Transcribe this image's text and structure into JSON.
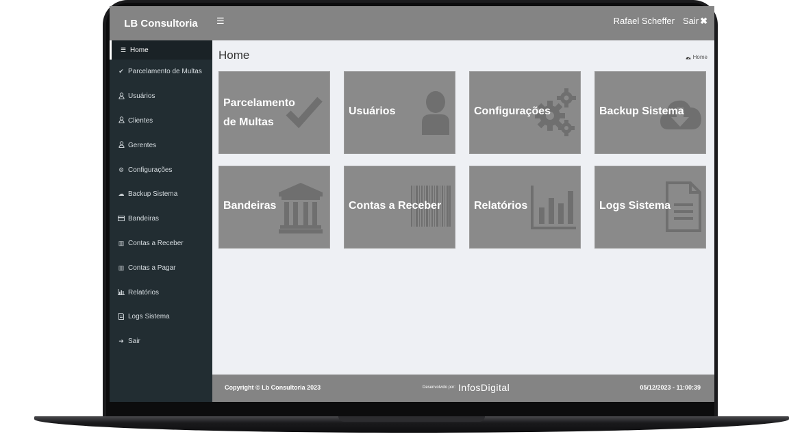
{
  "header": {
    "brand": "LB Consultoria",
    "menu_icon": "☰",
    "user_name": "Rafael Scheffer",
    "logout_label": "Sair",
    "logout_icon": "✖"
  },
  "sidebar": {
    "items": [
      {
        "label": "Home",
        "icon": "bars-icon"
      },
      {
        "label": "Parcelamento de Multas",
        "icon": "check-icon"
      },
      {
        "label": "Usuários",
        "icon": "user-icon"
      },
      {
        "label": "Clientes",
        "icon": "user-icon"
      },
      {
        "label": "Gerentes",
        "icon": "user-icon"
      },
      {
        "label": "Configurações",
        "icon": "cogs-icon"
      },
      {
        "label": "Backup Sistema",
        "icon": "cloud-download-icon"
      },
      {
        "label": "Bandeiras",
        "icon": "credit-card-icon"
      },
      {
        "label": "Contas a Receber",
        "icon": "barcode-icon"
      },
      {
        "label": "Contas a Pagar",
        "icon": "barcode-icon"
      },
      {
        "label": "Relatórios",
        "icon": "bar-chart-icon"
      },
      {
        "label": "Logs Sistema",
        "icon": "file-text-icon"
      },
      {
        "label": "Sair",
        "icon": "sign-out-icon"
      }
    ]
  },
  "page": {
    "title": "Home",
    "breadcrumb": "Home"
  },
  "tiles": [
    {
      "label_line1": "Parcelamento",
      "label_line2": "de Multas",
      "icon": "check-icon"
    },
    {
      "label_line1": "Usuários",
      "icon": "user-icon"
    },
    {
      "label_line1": "Configurações",
      "icon": "cogs-icon"
    },
    {
      "label_line1": "Backup Sistema",
      "icon": "cloud-download-icon"
    },
    {
      "label_line1": "Bandeiras",
      "icon": "bank-icon"
    },
    {
      "label_line1": "Contas a Receber",
      "icon": "barcode-icon"
    },
    {
      "label_line1": "Relatórios",
      "icon": "bar-chart-icon"
    },
    {
      "label_line1": "Logs Sistema",
      "icon": "file-text-icon"
    }
  ],
  "footer": {
    "copyright": "Copyright © Lb Consultoria 2023",
    "developed_by": "Desenvolvido por:",
    "developer_logo": "InfosDigital",
    "datetime": "05/12/2023 - 11:00:39"
  },
  "colors": {
    "topbar": "#848484",
    "sidebar": "#222d32",
    "tile": "#8a8a8a",
    "content_bg": "#eef0f4"
  }
}
